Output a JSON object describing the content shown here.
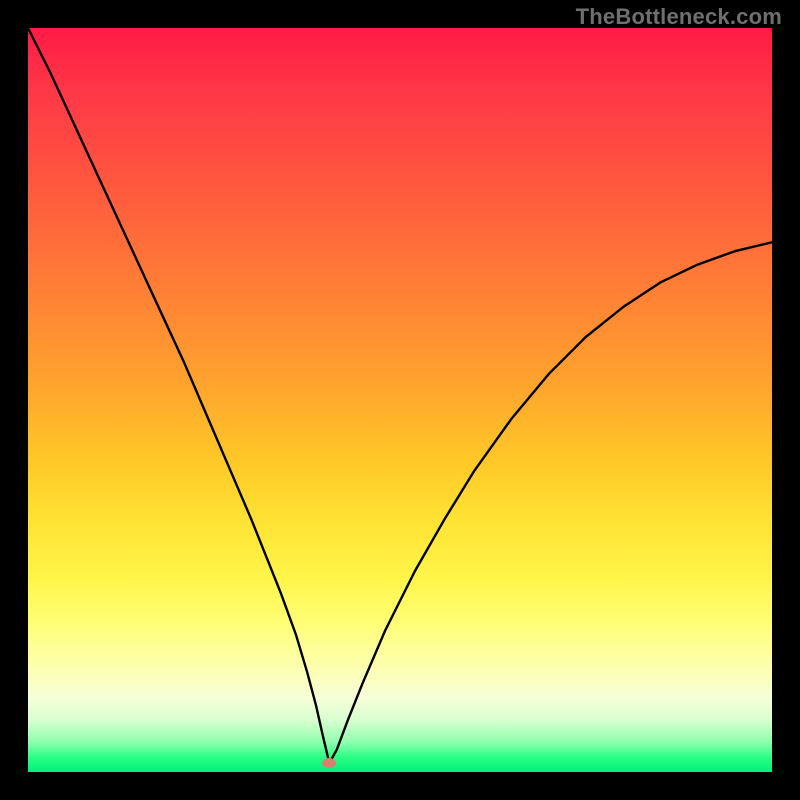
{
  "watermark": "TheBottleneck.com",
  "colors": {
    "frame_background": "#000000",
    "curve_stroke": "#000000",
    "dot_fill": "#d9806f",
    "watermark_color": "#6f6f6f",
    "gradient_stops": [
      {
        "pos": 0.0,
        "hex": "#ff1a46"
      },
      {
        "pos": 0.08,
        "hex": "#ff3647"
      },
      {
        "pos": 0.22,
        "hex": "#ff5a3e"
      },
      {
        "pos": 0.35,
        "hex": "#ff7f36"
      },
      {
        "pos": 0.48,
        "hex": "#ffa42d"
      },
      {
        "pos": 0.58,
        "hex": "#ffc727"
      },
      {
        "pos": 0.66,
        "hex": "#ffe233"
      },
      {
        "pos": 0.74,
        "hex": "#fff54a"
      },
      {
        "pos": 0.8,
        "hex": "#ffff77"
      },
      {
        "pos": 0.86,
        "hex": "#fdffb0"
      },
      {
        "pos": 0.9,
        "hex": "#f6ffd7"
      },
      {
        "pos": 0.93,
        "hex": "#d9ffd1"
      },
      {
        "pos": 0.96,
        "hex": "#8effad"
      },
      {
        "pos": 0.98,
        "hex": "#2aff86"
      },
      {
        "pos": 1.0,
        "hex": "#00f07a"
      }
    ]
  },
  "chart_data": {
    "type": "line",
    "title": "",
    "xlabel": "",
    "ylabel": "",
    "x_range": [
      0,
      100
    ],
    "y_range": [
      0,
      100
    ],
    "note": "Axes are unlabeled in the source image. Values are read as percent of the plotting area (x left→right, y bottom→top).",
    "marker": {
      "x": 40.5,
      "y": 1.2
    },
    "series": [
      {
        "name": "curve",
        "x": [
          0.0,
          3.0,
          6.0,
          9.0,
          12.0,
          15.0,
          18.0,
          21.0,
          24.0,
          27.0,
          30.0,
          32.0,
          34.0,
          36.0,
          37.5,
          38.7,
          39.6,
          40.5,
          41.5,
          43.0,
          45.0,
          48.0,
          52.0,
          56.0,
          60.0,
          65.0,
          70.0,
          75.0,
          80.0,
          85.0,
          90.0,
          95.0,
          100.0
        ],
        "y": [
          100.0,
          94.0,
          87.5,
          81.0,
          74.5,
          68.0,
          61.5,
          55.0,
          48.0,
          41.0,
          34.0,
          29.0,
          24.0,
          18.5,
          13.5,
          9.0,
          5.0,
          1.2,
          3.0,
          7.0,
          12.0,
          19.0,
          27.0,
          34.0,
          40.5,
          47.5,
          53.5,
          58.5,
          62.5,
          65.8,
          68.2,
          70.0,
          71.2
        ]
      }
    ]
  }
}
